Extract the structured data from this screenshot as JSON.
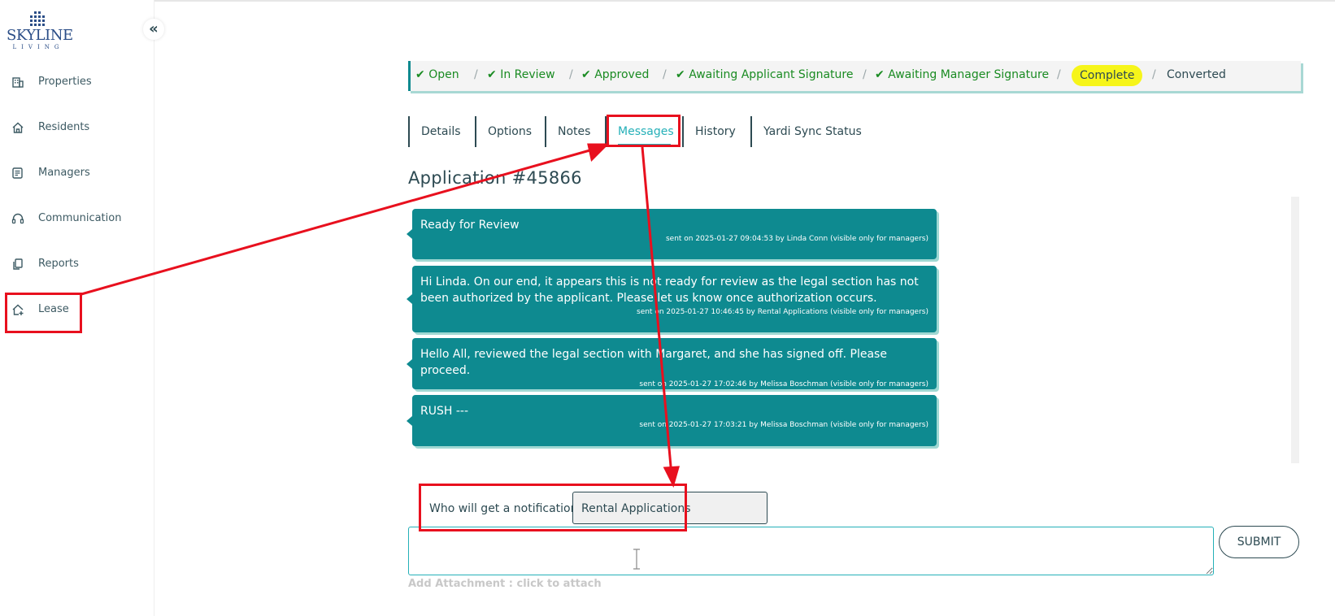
{
  "brand": {
    "logo_text": "SKYLINE",
    "logo_sub": "LIVING"
  },
  "sidebar": {
    "collapse_glyph": "«",
    "items": [
      {
        "label": "Properties",
        "icon": "building-icon"
      },
      {
        "label": "Residents",
        "icon": "home-icon"
      },
      {
        "label": "Managers",
        "icon": "manager-list-icon"
      },
      {
        "label": "Communication",
        "icon": "headset-icon"
      },
      {
        "label": "Reports",
        "icon": "copy-icon"
      },
      {
        "label": "Lease",
        "icon": "house-plus-icon"
      }
    ]
  },
  "status_steps": [
    {
      "label": "Open",
      "done": true
    },
    {
      "label": "In Review",
      "done": true
    },
    {
      "label": "Approved",
      "done": true
    },
    {
      "label": "Awaiting Applicant Signature",
      "done": true
    },
    {
      "label": "Awaiting Manager Signature",
      "done": true
    },
    {
      "label": "Complete",
      "current": true
    },
    {
      "label": "Converted"
    }
  ],
  "status_colors": {
    "done": "#1a8b22",
    "current_bg": "#f6f51a",
    "accent": "#0e8a90"
  },
  "tabs": [
    {
      "label": "Details"
    },
    {
      "label": "Options"
    },
    {
      "label": "Notes"
    },
    {
      "label": "Messages",
      "active": true
    },
    {
      "label": "History"
    },
    {
      "label": "Yardi Sync Status"
    }
  ],
  "application": {
    "title": "Application #45866"
  },
  "messages": [
    {
      "text": "Ready for Review",
      "meta": "sent on 2025-01-27 09:04:53 by Linda Conn (visible only for managers)"
    },
    {
      "text": "Hi Linda. On our end, it appears this is not ready for review as the legal section has not been authorized by the applicant. Please let us know once authorization occurs.",
      "meta": "sent on 2025-01-27 10:46:45 by Rental Applications (visible only for managers)"
    },
    {
      "text": "Hello All, reviewed the legal section with Margaret, and she has signed off. Please proceed.",
      "meta": "sent on 2025-01-27 17:02:46 by Melissa Boschman (visible only for managers)"
    },
    {
      "text": "RUSH ---",
      "meta": "sent on 2025-01-27 17:03:21 by Melissa Boschman (visible only for managers)"
    }
  ],
  "notification": {
    "label": "Who will get a notification:",
    "value": "Rental Applications"
  },
  "compose": {
    "placeholder": "",
    "submit_label": "SUBMIT",
    "attach_label": "Add Attachment : click to attach"
  },
  "annotation_color": "#e8101e"
}
